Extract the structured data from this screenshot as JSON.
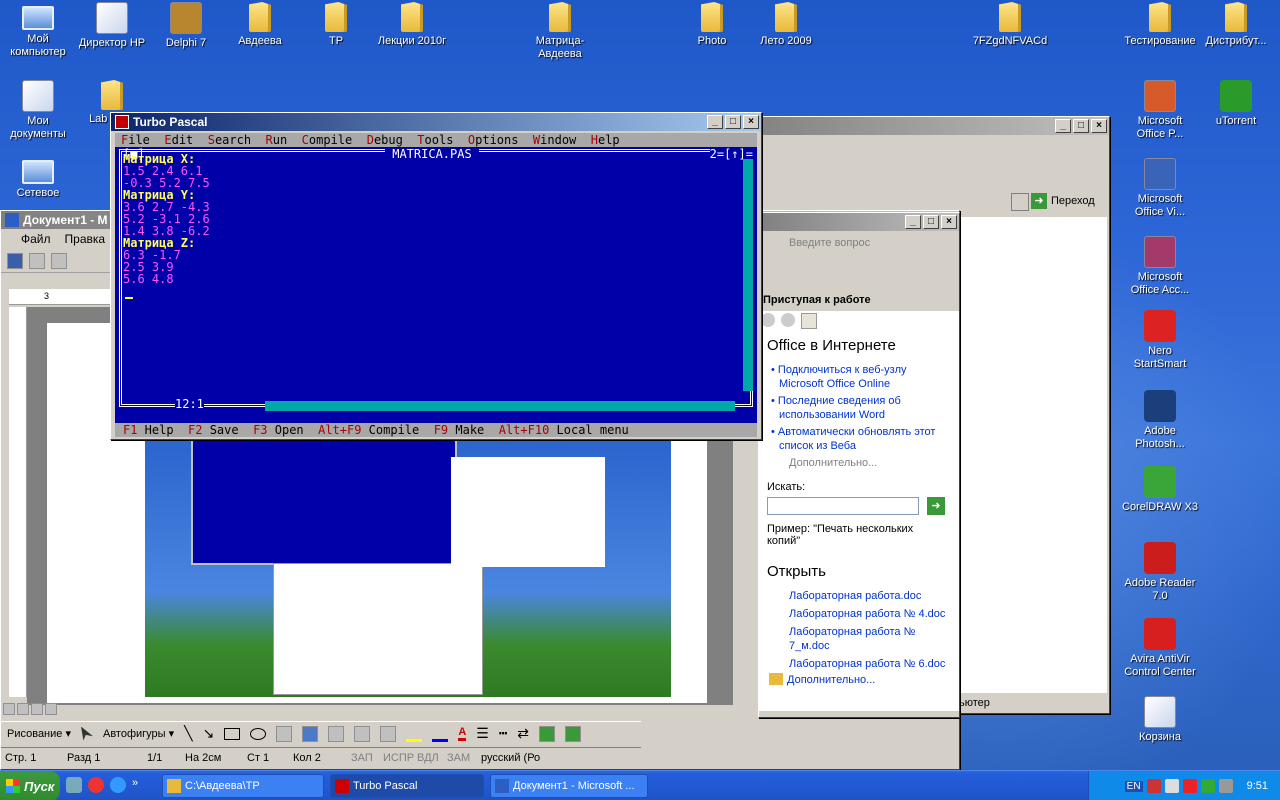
{
  "desktop_icons": [
    {
      "label": "Мой компьютер",
      "icon": "my-computer-icon"
    },
    {
      "label": "Директор HP",
      "icon": "hp-director-icon"
    },
    {
      "label": "Delphi 7",
      "icon": "delphi-icon"
    },
    {
      "label": "Авдеева",
      "icon": "folder-icon"
    },
    {
      "label": "TP",
      "icon": "folder-icon"
    },
    {
      "label": "Лекции 2010г",
      "icon": "folder-icon"
    },
    {
      "label": "Матрица-Авдеева",
      "icon": "folder-icon"
    },
    {
      "label": "Photo",
      "icon": "folder-icon"
    },
    {
      "label": "Лето 2009",
      "icon": "folder-icon"
    },
    {
      "label": "7FZgdNFVACd",
      "icon": "folder-icon"
    },
    {
      "label": "Тестирование",
      "icon": "folder-icon"
    },
    {
      "label": "Дистрибут...",
      "icon": "folder-icon"
    },
    {
      "label": "Мои документы",
      "icon": "my-documents-icon"
    },
    {
      "label": "Lab Func",
      "icon": "folder-icon"
    },
    {
      "label": "Сетевое",
      "icon": "network-icon"
    },
    {
      "label": "Microsoft Office P...",
      "icon": "powerpoint-icon"
    },
    {
      "label": "uTorrent",
      "icon": "utorrent-icon"
    },
    {
      "label": "Microsoft Office Vi...",
      "icon": "visio-icon"
    },
    {
      "label": "Microsoft Office Acc...",
      "icon": "access-icon"
    },
    {
      "label": "Nero StartSmart",
      "icon": "nero-icon"
    },
    {
      "label": "Adobe Photosh...",
      "icon": "photoshop-icon"
    },
    {
      "label": "CorelDRAW X3",
      "icon": "coreldraw-icon"
    },
    {
      "label": "Adobe Reader 7.0",
      "icon": "adobe-reader-icon"
    },
    {
      "label": "Avira AntiVir Control Center",
      "icon": "avira-icon"
    },
    {
      "label": "Корзина",
      "icon": "recycle-bin-icon"
    }
  ],
  "turbo_pascal": {
    "title": "Turbo Pascal",
    "menu": [
      "File",
      "Edit",
      "Search",
      "Run",
      "Compile",
      "Debug",
      "Tools",
      "Options",
      "Window",
      "Help"
    ],
    "file_name": "MATRICA.PAS",
    "window_number": "2",
    "lines": [
      {
        "text": "Матрица X:",
        "style": "y"
      },
      {
        "text": "1.5 2.4 6.1",
        "style": "m"
      },
      {
        "text": "-0.3 5.2 7.5",
        "style": "m"
      },
      {
        "text": "Матрица Y:",
        "style": "y"
      },
      {
        "text": "3.6 2.7 -4.3",
        "style": "m"
      },
      {
        "text": "5.2 -3.1 2.6",
        "style": "m"
      },
      {
        "text": "1.4 3.8 -6.2",
        "style": "m"
      },
      {
        "text": "Матрица Z:",
        "style": "y"
      },
      {
        "text": "6.3 -1.7",
        "style": "m"
      },
      {
        "text": "2.5 3.9",
        "style": "m"
      },
      {
        "text": "5.6 4.8",
        "style": "m"
      }
    ],
    "cursor_pos": "12:1",
    "status": [
      {
        "key": "F1",
        "label": "Help"
      },
      {
        "key": "F2",
        "label": "Save"
      },
      {
        "key": "F3",
        "label": "Open"
      },
      {
        "key": "Alt+F9",
        "label": "Compile"
      },
      {
        "key": "F9",
        "label": "Make"
      },
      {
        "key": "Alt+F10",
        "label": "Local menu"
      }
    ]
  },
  "word": {
    "title": "Документ1 - M",
    "menu": [
      "Файл",
      "Правка"
    ],
    "ruler_start": "3",
    "status": {
      "page": "Стр. 1",
      "section": "Разд 1",
      "pages": "1/1",
      "at": "На 2см",
      "line": "Ст 1",
      "col": "Кол 2",
      "rec": "ЗАП",
      "trk": "ИСПР",
      "ext": "ВДЛ",
      "ovr": "ЗАМ",
      "lang": "русский (Ро"
    },
    "drawing": {
      "draw_label": "Рисование ▾",
      "autoshapes_label": "Автофигуры ▾"
    },
    "question_placeholder": "Введите вопрос"
  },
  "task_pane": {
    "header": "Приступая к работе",
    "office_online_title": "Office в Интернете",
    "links": [
      "Подключиться к веб-узлу Microsoft Office Online",
      "Последние сведения об использовании Word",
      "Автоматически обновлять этот список из Веба"
    ],
    "more": "Дополнительно...",
    "search_label": "Искать:",
    "example": "Пример: \"Печать нескольких копий\"",
    "open_title": "Открыть",
    "open_files": [
      "Лабораторная работа.doc",
      "Лабораторная работа № 4.doc",
      "Лабораторная работа № 7_м.doc",
      "Лабораторная работа № 6.doc"
    ],
    "open_more": "Дополнительно..."
  },
  "explorer": {
    "go_label": "Переход",
    "status_right": "ьютер"
  },
  "taskbar": {
    "start": "Пуск",
    "tasks": [
      "C:\\Авдеева\\TP",
      "Turbo Pascal",
      "Документ1 - Microsoft ..."
    ],
    "active_task": "Turbo Pascal",
    "lang": "EN",
    "clock": "9:51"
  }
}
